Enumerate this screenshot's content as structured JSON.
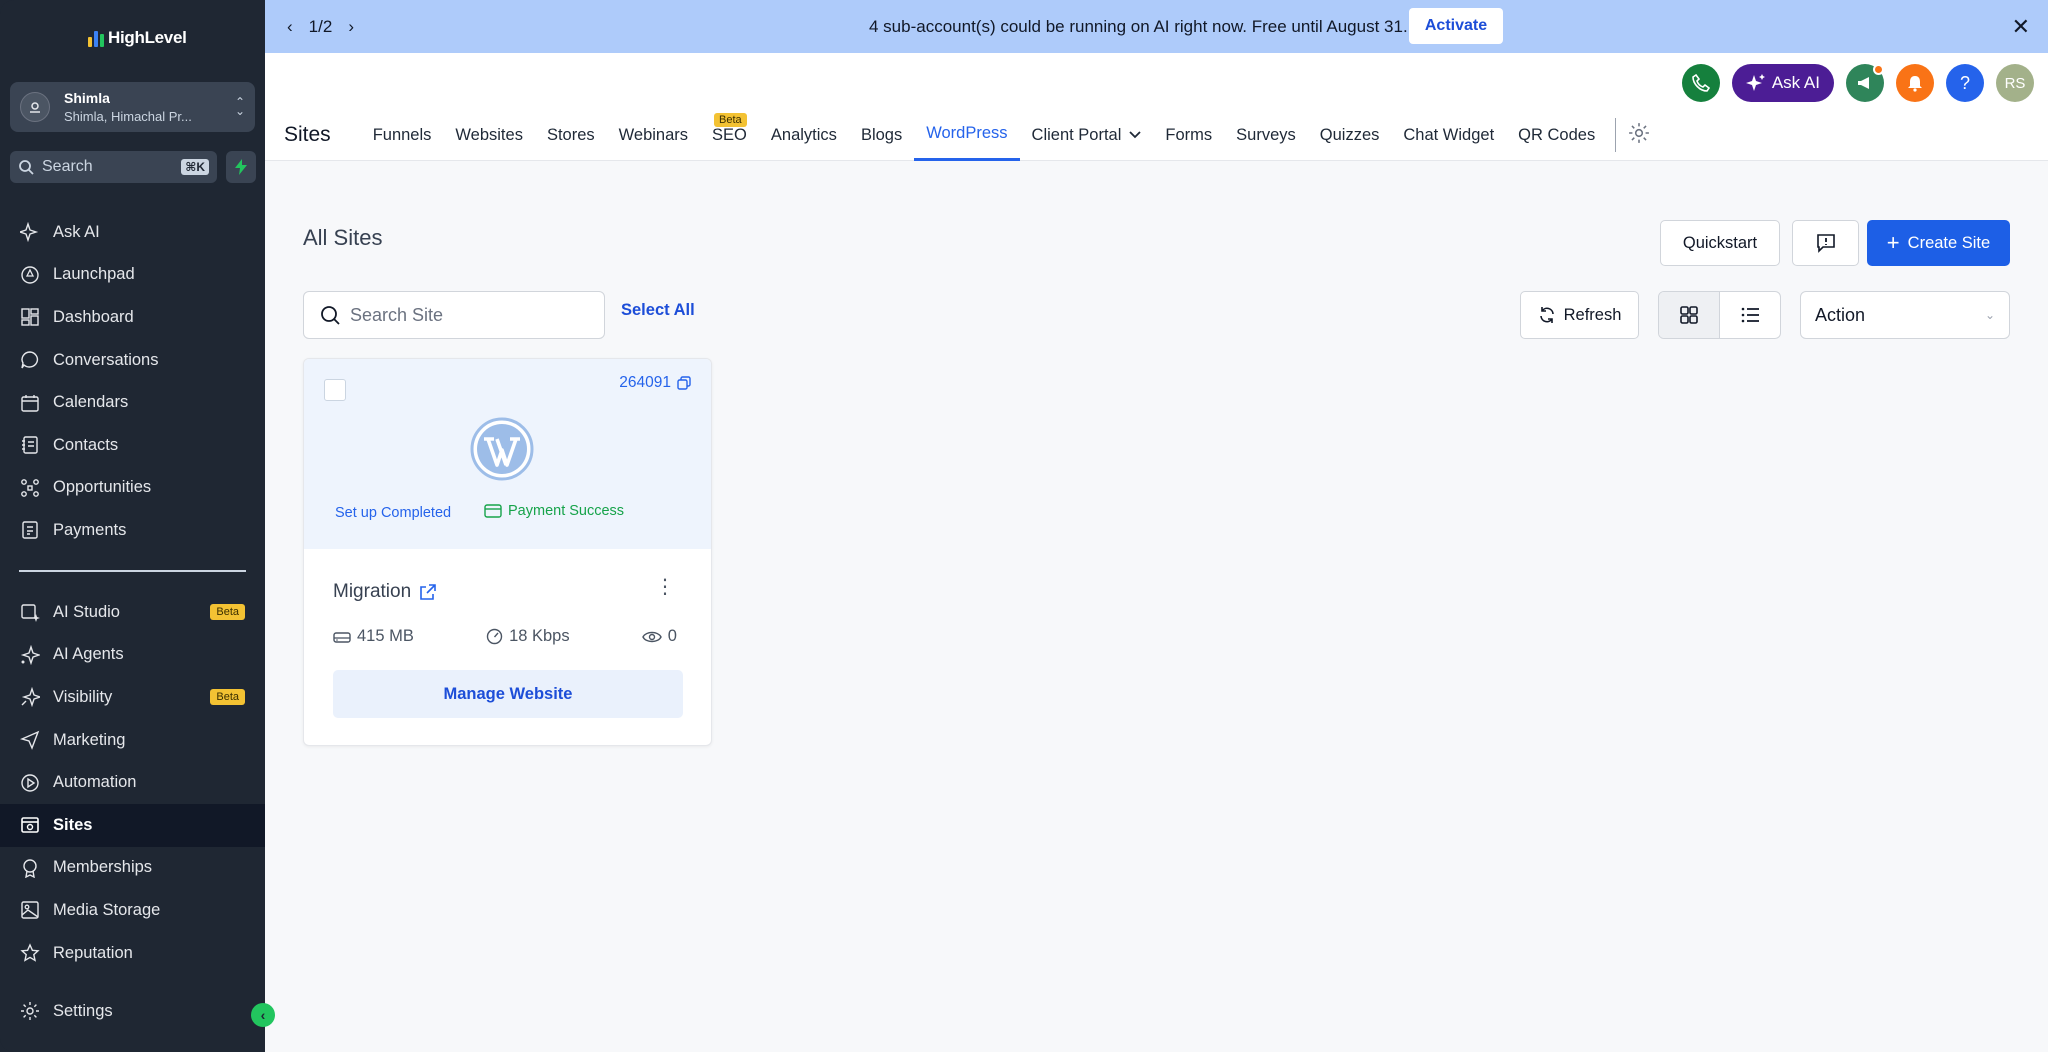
{
  "brand": {
    "logo_text": "HighLevel"
  },
  "account": {
    "name": "Shimla",
    "location": "Shimla, Himachal Pr..."
  },
  "sidebar": {
    "search_placeholder": "Search",
    "search_shortcut": "⌘K",
    "items": [
      {
        "label": "Ask AI",
        "icon": "sparkle-icon"
      },
      {
        "label": "Launchpad",
        "icon": "rocket-icon"
      },
      {
        "label": "Dashboard",
        "icon": "dashboard-icon"
      },
      {
        "label": "Conversations",
        "icon": "chat-bubble-icon"
      },
      {
        "label": "Calendars",
        "icon": "calendar-icon"
      },
      {
        "label": "Contacts",
        "icon": "contacts-icon"
      },
      {
        "label": "Opportunities",
        "icon": "opportunities-icon"
      },
      {
        "label": "Payments",
        "icon": "payments-icon"
      }
    ],
    "items2": [
      {
        "label": "AI Studio",
        "badge": "Beta"
      },
      {
        "label": "AI Agents"
      },
      {
        "label": "Visibility",
        "badge": "Beta"
      },
      {
        "label": "Marketing"
      },
      {
        "label": "Automation"
      },
      {
        "label": "Sites",
        "active": true
      },
      {
        "label": "Memberships"
      },
      {
        "label": "Media Storage"
      },
      {
        "label": "Reputation"
      }
    ],
    "settings_label": "Settings"
  },
  "banner": {
    "pager": "1/2",
    "message": "4 sub-account(s) could be running on AI right now. Free until August 31.",
    "activate_label": "Activate"
  },
  "header": {
    "ask_ai_label": "Ask AI",
    "help_label": "?",
    "avatar_initials": "RS",
    "page_title": "Sites",
    "tabs": [
      {
        "label": "Funnels"
      },
      {
        "label": "Websites"
      },
      {
        "label": "Stores"
      },
      {
        "label": "Webinars"
      },
      {
        "label": "SEO",
        "badge": "Beta"
      },
      {
        "label": "Analytics"
      },
      {
        "label": "Blogs"
      },
      {
        "label": "WordPress",
        "active": true
      },
      {
        "label": "Client Portal"
      },
      {
        "label": "Forms"
      },
      {
        "label": "Surveys"
      },
      {
        "label": "Quizzes"
      },
      {
        "label": "Chat Widget"
      },
      {
        "label": "QR Codes"
      }
    ]
  },
  "content": {
    "title": "All Sites",
    "quickstart_label": "Quickstart",
    "create_label": "Create Site",
    "search_placeholder": "Search Site",
    "select_all_label": "Select All",
    "refresh_label": "Refresh",
    "action_label": "Action"
  },
  "site_card": {
    "id": "264091",
    "setup_status": "Set up Completed",
    "payment_status": "Payment Success",
    "name": "Migration",
    "storage": "415 MB",
    "bandwidth": "18 Kbps",
    "views": "0",
    "manage_label": "Manage Website"
  },
  "colors": {
    "sidebar_bg": "#1f2733",
    "banner_bg": "#aecbfa",
    "primary": "#1d5fe6",
    "ask_ai": "#4c1d95",
    "success": "#16a34a"
  }
}
